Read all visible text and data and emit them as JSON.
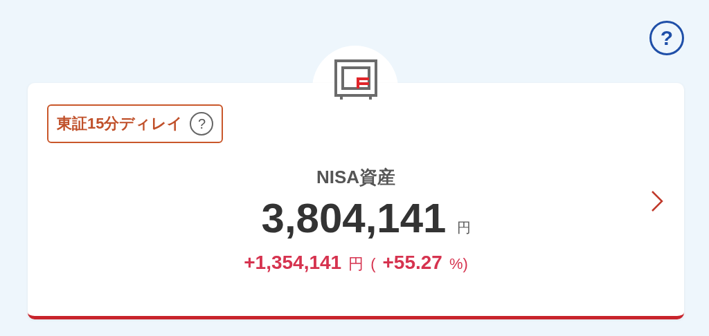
{
  "help_button": "?",
  "asset_card": {
    "badge": {
      "label": "東証15分ディレイ",
      "help": "?"
    },
    "title": "NISA資産",
    "total": {
      "value": "3,804,141",
      "unit": "円"
    },
    "change": {
      "value": "+1,354,141",
      "unit": "円",
      "open": "(",
      "percent": "+55.27",
      "close": "%)"
    }
  }
}
